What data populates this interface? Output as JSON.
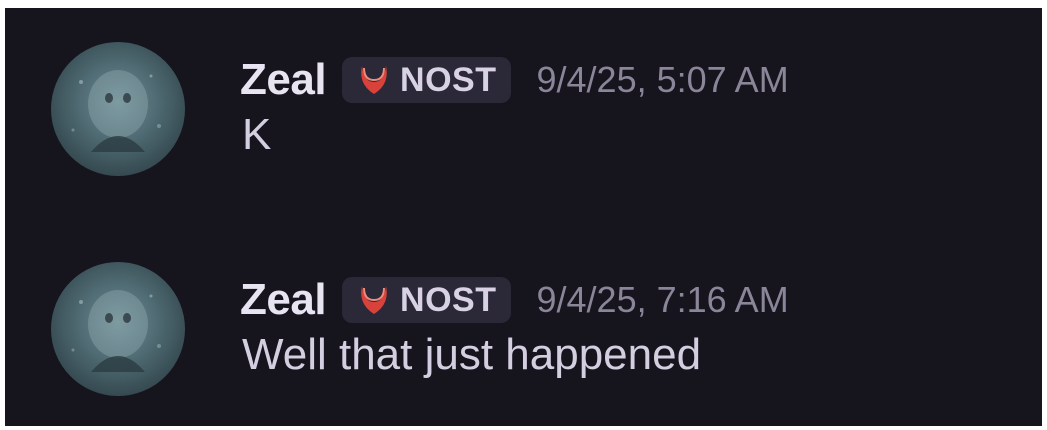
{
  "messages": [
    {
      "author": "Zeal",
      "tag": {
        "label": "NOST",
        "icon": "red-crescent-icon"
      },
      "timestamp": "9/4/25, 5:07 AM",
      "text": "K"
    },
    {
      "author": "Zeal",
      "tag": {
        "label": "NOST",
        "icon": "red-crescent-icon"
      },
      "timestamp": "9/4/25, 7:16 AM",
      "text": "Well that just happened"
    }
  ],
  "colors": {
    "background": "#16141d",
    "username": "#e9e4f2",
    "timestamp": "#8a8598",
    "tag_background": "#2b2838",
    "tag_icon": "#d9423a",
    "message_text": "#d4cfe0"
  }
}
